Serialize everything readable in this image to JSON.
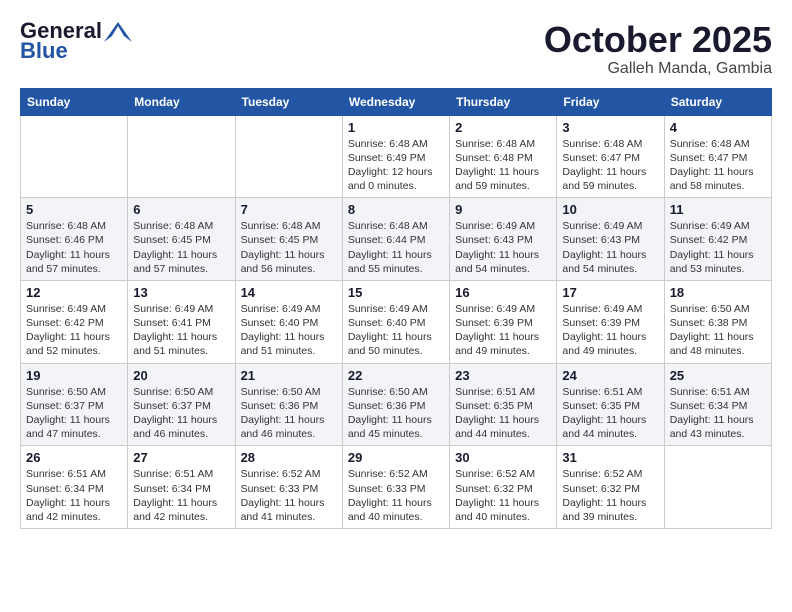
{
  "header": {
    "logo_line1": "General",
    "logo_line2": "Blue",
    "month": "October 2025",
    "location": "Galleh Manda, Gambia"
  },
  "weekdays": [
    "Sunday",
    "Monday",
    "Tuesday",
    "Wednesday",
    "Thursday",
    "Friday",
    "Saturday"
  ],
  "weeks": [
    [
      {
        "day": "",
        "info": ""
      },
      {
        "day": "",
        "info": ""
      },
      {
        "day": "",
        "info": ""
      },
      {
        "day": "1",
        "info": "Sunrise: 6:48 AM\nSunset: 6:49 PM\nDaylight: 12 hours and 0 minutes."
      },
      {
        "day": "2",
        "info": "Sunrise: 6:48 AM\nSunset: 6:48 PM\nDaylight: 11 hours and 59 minutes."
      },
      {
        "day": "3",
        "info": "Sunrise: 6:48 AM\nSunset: 6:47 PM\nDaylight: 11 hours and 59 minutes."
      },
      {
        "day": "4",
        "info": "Sunrise: 6:48 AM\nSunset: 6:47 PM\nDaylight: 11 hours and 58 minutes."
      }
    ],
    [
      {
        "day": "5",
        "info": "Sunrise: 6:48 AM\nSunset: 6:46 PM\nDaylight: 11 hours and 57 minutes."
      },
      {
        "day": "6",
        "info": "Sunrise: 6:48 AM\nSunset: 6:45 PM\nDaylight: 11 hours and 57 minutes."
      },
      {
        "day": "7",
        "info": "Sunrise: 6:48 AM\nSunset: 6:45 PM\nDaylight: 11 hours and 56 minutes."
      },
      {
        "day": "8",
        "info": "Sunrise: 6:48 AM\nSunset: 6:44 PM\nDaylight: 11 hours and 55 minutes."
      },
      {
        "day": "9",
        "info": "Sunrise: 6:49 AM\nSunset: 6:43 PM\nDaylight: 11 hours and 54 minutes."
      },
      {
        "day": "10",
        "info": "Sunrise: 6:49 AM\nSunset: 6:43 PM\nDaylight: 11 hours and 54 minutes."
      },
      {
        "day": "11",
        "info": "Sunrise: 6:49 AM\nSunset: 6:42 PM\nDaylight: 11 hours and 53 minutes."
      }
    ],
    [
      {
        "day": "12",
        "info": "Sunrise: 6:49 AM\nSunset: 6:42 PM\nDaylight: 11 hours and 52 minutes."
      },
      {
        "day": "13",
        "info": "Sunrise: 6:49 AM\nSunset: 6:41 PM\nDaylight: 11 hours and 51 minutes."
      },
      {
        "day": "14",
        "info": "Sunrise: 6:49 AM\nSunset: 6:40 PM\nDaylight: 11 hours and 51 minutes."
      },
      {
        "day": "15",
        "info": "Sunrise: 6:49 AM\nSunset: 6:40 PM\nDaylight: 11 hours and 50 minutes."
      },
      {
        "day": "16",
        "info": "Sunrise: 6:49 AM\nSunset: 6:39 PM\nDaylight: 11 hours and 49 minutes."
      },
      {
        "day": "17",
        "info": "Sunrise: 6:49 AM\nSunset: 6:39 PM\nDaylight: 11 hours and 49 minutes."
      },
      {
        "day": "18",
        "info": "Sunrise: 6:50 AM\nSunset: 6:38 PM\nDaylight: 11 hours and 48 minutes."
      }
    ],
    [
      {
        "day": "19",
        "info": "Sunrise: 6:50 AM\nSunset: 6:37 PM\nDaylight: 11 hours and 47 minutes."
      },
      {
        "day": "20",
        "info": "Sunrise: 6:50 AM\nSunset: 6:37 PM\nDaylight: 11 hours and 46 minutes."
      },
      {
        "day": "21",
        "info": "Sunrise: 6:50 AM\nSunset: 6:36 PM\nDaylight: 11 hours and 46 minutes."
      },
      {
        "day": "22",
        "info": "Sunrise: 6:50 AM\nSunset: 6:36 PM\nDaylight: 11 hours and 45 minutes."
      },
      {
        "day": "23",
        "info": "Sunrise: 6:51 AM\nSunset: 6:35 PM\nDaylight: 11 hours and 44 minutes."
      },
      {
        "day": "24",
        "info": "Sunrise: 6:51 AM\nSunset: 6:35 PM\nDaylight: 11 hours and 44 minutes."
      },
      {
        "day": "25",
        "info": "Sunrise: 6:51 AM\nSunset: 6:34 PM\nDaylight: 11 hours and 43 minutes."
      }
    ],
    [
      {
        "day": "26",
        "info": "Sunrise: 6:51 AM\nSunset: 6:34 PM\nDaylight: 11 hours and 42 minutes."
      },
      {
        "day": "27",
        "info": "Sunrise: 6:51 AM\nSunset: 6:34 PM\nDaylight: 11 hours and 42 minutes."
      },
      {
        "day": "28",
        "info": "Sunrise: 6:52 AM\nSunset: 6:33 PM\nDaylight: 11 hours and 41 minutes."
      },
      {
        "day": "29",
        "info": "Sunrise: 6:52 AM\nSunset: 6:33 PM\nDaylight: 11 hours and 40 minutes."
      },
      {
        "day": "30",
        "info": "Sunrise: 6:52 AM\nSunset: 6:32 PM\nDaylight: 11 hours and 40 minutes."
      },
      {
        "day": "31",
        "info": "Sunrise: 6:52 AM\nSunset: 6:32 PM\nDaylight: 11 hours and 39 minutes."
      },
      {
        "day": "",
        "info": ""
      }
    ]
  ]
}
